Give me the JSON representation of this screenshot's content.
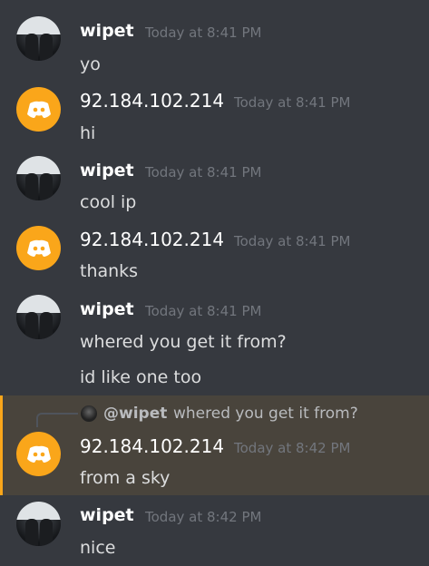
{
  "messages": [
    {
      "author": "wipet",
      "timestamp": "Today at 8:41 PM",
      "lines": [
        "yo"
      ]
    },
    {
      "author": "92.184.102.214",
      "timestamp": "Today at 8:41 PM",
      "lines": [
        "hi"
      ]
    },
    {
      "author": "wipet",
      "timestamp": "Today at 8:41 PM",
      "lines": [
        "cool ip"
      ]
    },
    {
      "author": "92.184.102.214",
      "timestamp": "Today at 8:41 PM",
      "lines": [
        "thanks"
      ]
    },
    {
      "author": "wipet",
      "timestamp": "Today at 8:41 PM",
      "lines": [
        "whered you get it from?",
        "id like one too"
      ]
    },
    {
      "author": "92.184.102.214",
      "timestamp": "Today at 8:42 PM",
      "lines": [
        "from a sky"
      ],
      "reply": {
        "author": "@wipet",
        "text": "whered you get it from?"
      }
    },
    {
      "author": "wipet",
      "timestamp": "Today at 8:42 PM",
      "lines": [
        "nice"
      ]
    }
  ],
  "colors": {
    "background": "#36393f",
    "highlight": "#49443c",
    "accent": "#faa61a",
    "timestamp": "#72767d"
  }
}
